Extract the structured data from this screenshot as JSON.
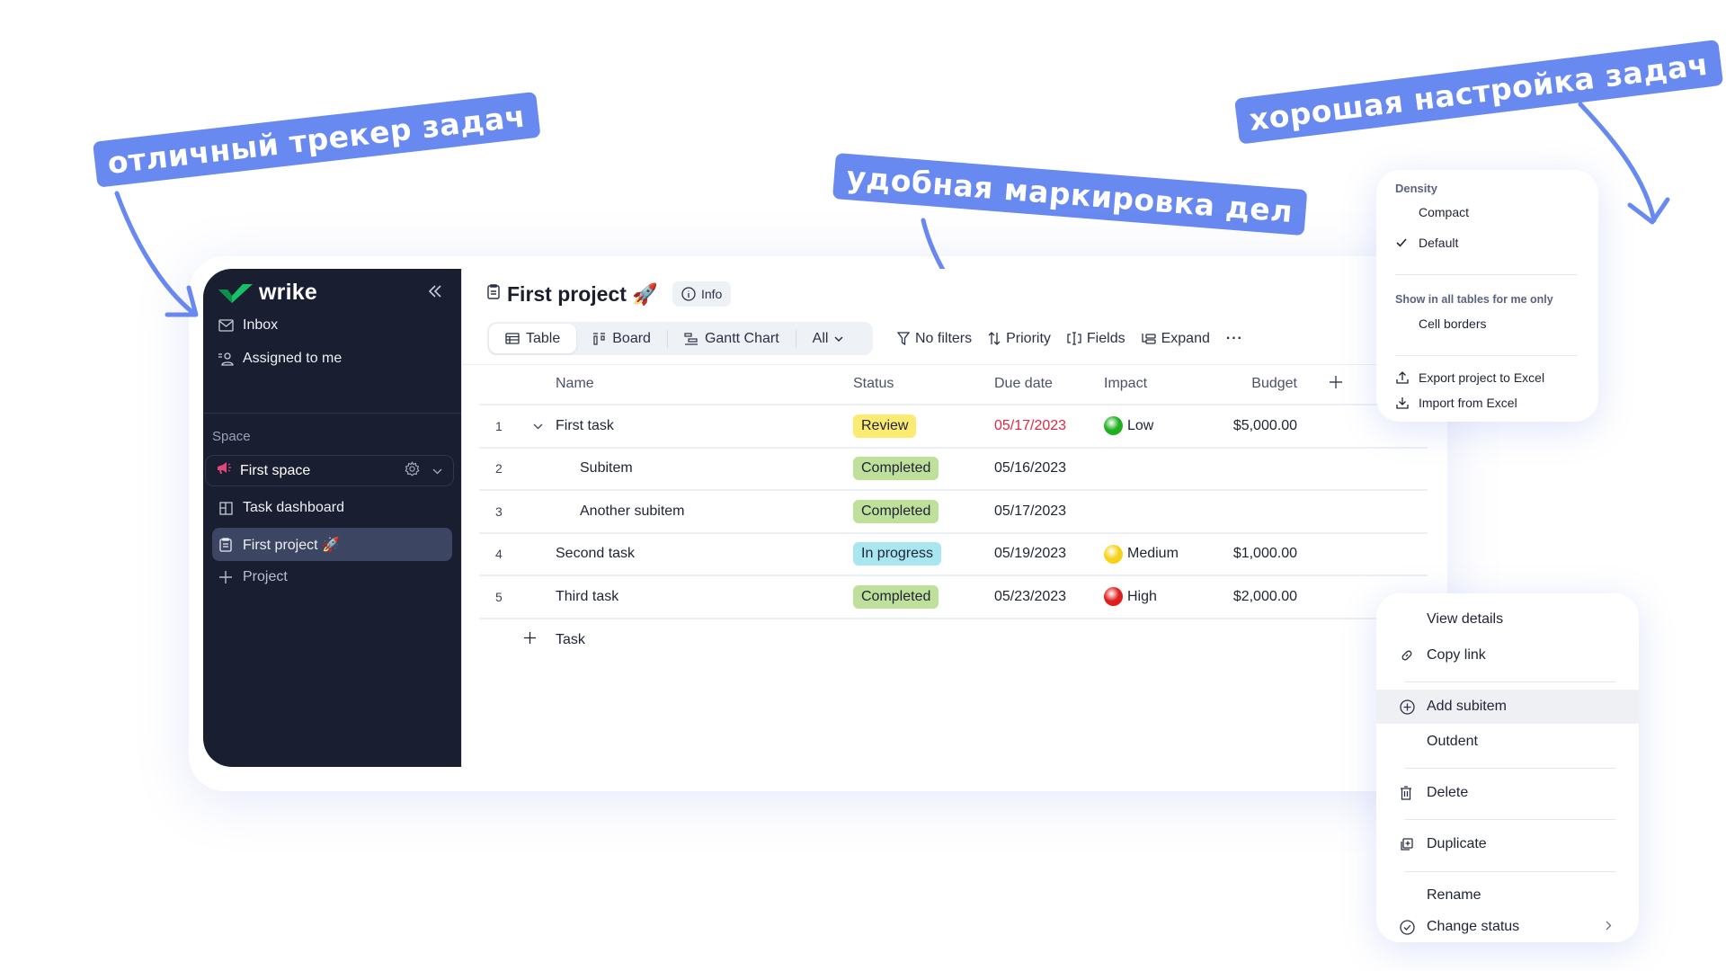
{
  "annotations": [
    "отличный трекер задач",
    "удобная маркировка дел",
    "хорошая настройка задач"
  ],
  "sidebar": {
    "logo_text": "wrike",
    "items": [
      {
        "label": "Inbox",
        "icon": "inbox-icon"
      },
      {
        "label": "Assigned to me",
        "icon": "assigned-icon"
      }
    ],
    "space_label": "Space",
    "space_select": "First space",
    "space_items": [
      {
        "label": "Task dashboard",
        "icon": "dashboard-icon"
      },
      {
        "label": "First project 🚀",
        "icon": "project-icon",
        "active": true
      },
      {
        "label": "Project",
        "icon": "plus-icon"
      }
    ]
  },
  "main": {
    "title": "First project 🚀",
    "info_label": "Info",
    "views": [
      {
        "label": "Table",
        "active": true
      },
      {
        "label": "Board"
      },
      {
        "label": "Gantt Chart"
      },
      {
        "label": "All"
      }
    ],
    "toolbar": {
      "filters": "No filters",
      "priority": "Priority",
      "fields": "Fields",
      "expand": "Expand",
      "more": "···"
    },
    "table": {
      "columns": [
        "Name",
        "Status",
        "Due date",
        "Impact",
        "Budget"
      ],
      "rows": [
        {
          "num": "1",
          "name": "First task",
          "status": "Review",
          "due": "05/17/2023",
          "overdue": true,
          "impact": "Low",
          "budget": "$5,000.00",
          "expandable": true
        },
        {
          "num": "2",
          "name": "Subitem",
          "status": "Completed",
          "due": "05/16/2023",
          "impact": "",
          "budget": "",
          "sub": true
        },
        {
          "num": "3",
          "name": "Another subitem",
          "status": "Completed",
          "due": "05/17/2023",
          "impact": "",
          "budget": "",
          "sub": true
        },
        {
          "num": "4",
          "name": "Second task",
          "status": "In progress",
          "due": "05/19/2023",
          "impact": "Medium",
          "budget": "$1,000.00"
        },
        {
          "num": "5",
          "name": "Third task",
          "status": "Completed",
          "due": "05/23/2023",
          "impact": "High",
          "budget": "$2,000.00"
        }
      ],
      "add_task_label": "Task"
    }
  },
  "colors": {
    "sidebar_bg": "#1a1e31",
    "accent_annotation": "#6889f0",
    "status_review": "#fdeb71",
    "status_completed": "#bfe09b",
    "status_in_progress": "#a8e6f0",
    "impact_low": "#1fb01f",
    "impact_medium": "#f7d21b",
    "impact_high": "#e01e1e",
    "overdue": "#e0283f",
    "logo_green": "#16c265"
  },
  "density_menu": {
    "heading": "Density",
    "options": [
      {
        "label": "Compact",
        "checked": false
      },
      {
        "label": "Default",
        "checked": true
      }
    ],
    "heading2": "Show in all tables for me only",
    "toggle_option": "Cell borders",
    "actions": [
      {
        "label": "Export project to Excel",
        "icon": "export-icon"
      },
      {
        "label": "Import from Excel",
        "icon": "import-icon"
      }
    ]
  },
  "context_menu": {
    "items": [
      {
        "label": "View details"
      },
      {
        "label": "Copy link",
        "icon": "link-icon"
      },
      {
        "label": "Add subitem",
        "icon": "add-circle-icon",
        "hover": true
      },
      {
        "label": "Outdent"
      },
      {
        "label": "Delete",
        "icon": "trash-icon"
      },
      {
        "label": "Duplicate",
        "icon": "duplicate-icon"
      },
      {
        "label": "Rename"
      },
      {
        "label": "Change status",
        "icon": "check-circle-icon",
        "submenu": true
      }
    ]
  }
}
